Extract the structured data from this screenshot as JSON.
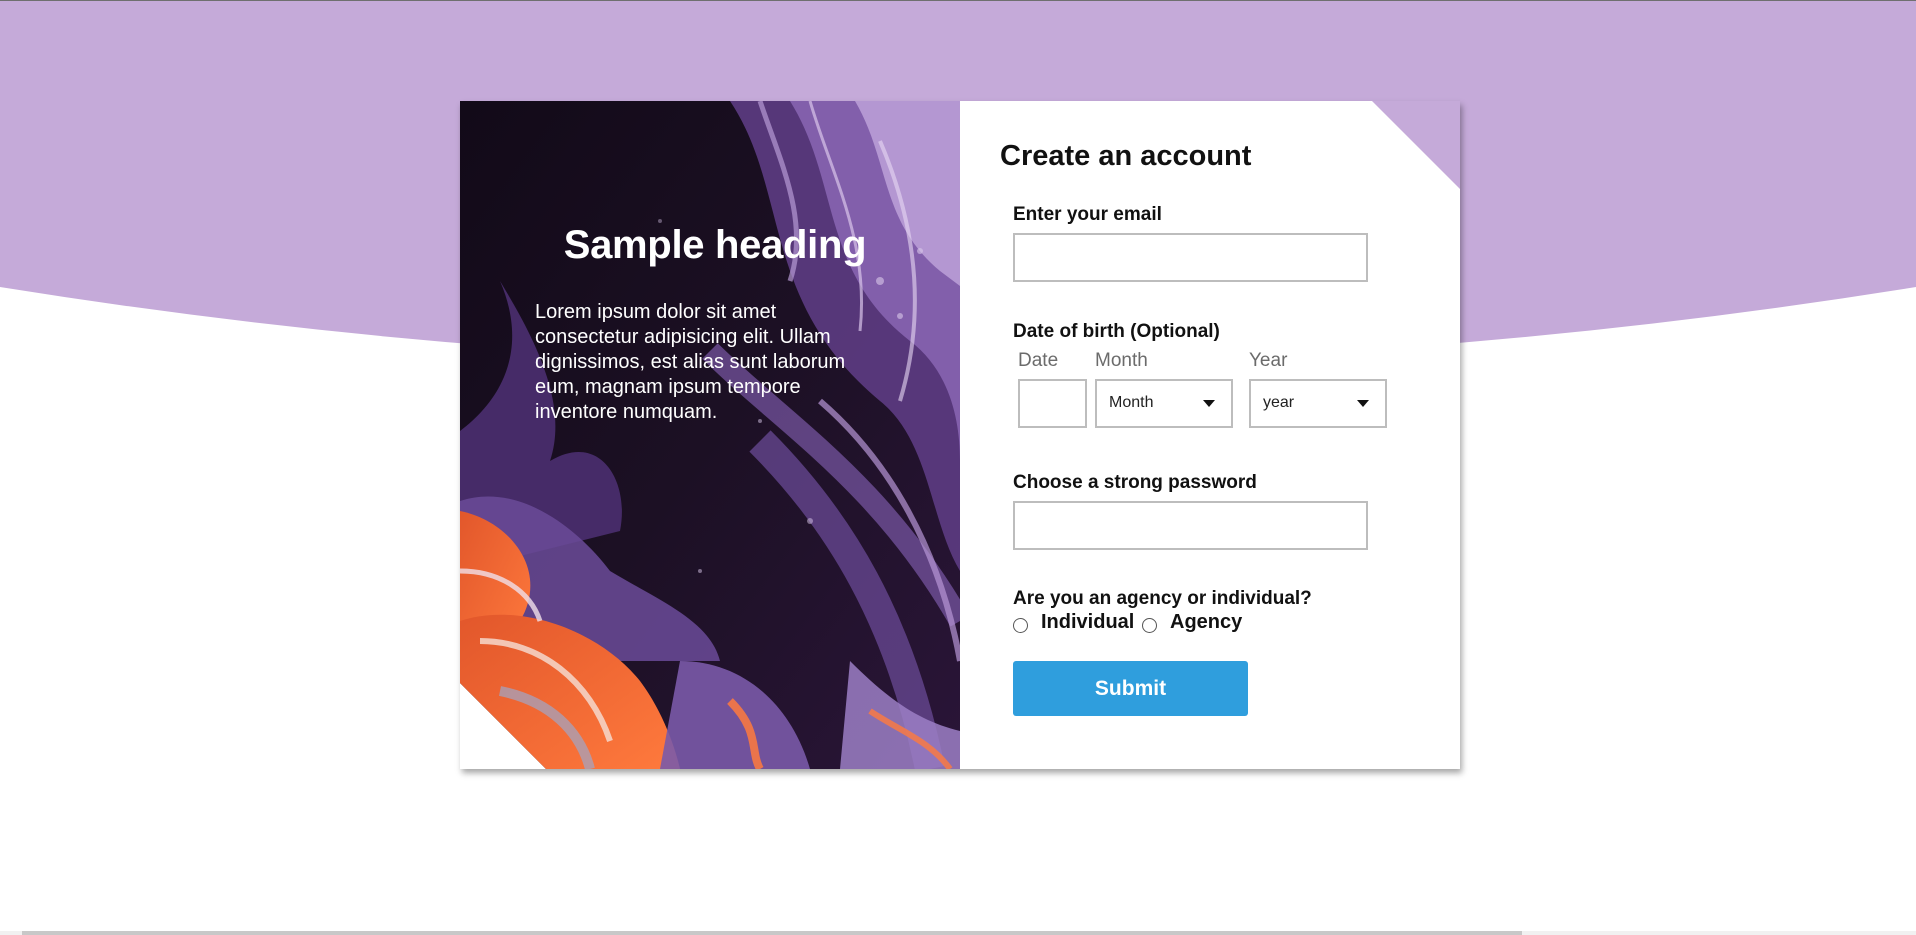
{
  "colors": {
    "wave": "#c5aad9",
    "submit": "#2f9edd",
    "input_border": "#bdbdbd"
  },
  "hero": {
    "heading": "Sample heading",
    "body": "Lorem ipsum dolor sit amet consectetur adipisicing elit. Ullam dignissimos, est alias sunt laborum eum, magnam ipsum tempore inventore numquam."
  },
  "form": {
    "title": "Create an account",
    "email": {
      "label": "Enter your email",
      "value": "",
      "placeholder": ""
    },
    "dob": {
      "label": "Date of birth (Optional)",
      "date_label": "Date",
      "month_label": "Month",
      "year_label": "Year",
      "date_value": "",
      "month_selected": "Month",
      "year_selected": "year"
    },
    "password": {
      "label": "Choose a strong password",
      "value": ""
    },
    "account_type": {
      "question": "Are you an agency or individual?",
      "options": [
        "Individual",
        "Agency"
      ]
    },
    "submit_label": "Submit"
  }
}
